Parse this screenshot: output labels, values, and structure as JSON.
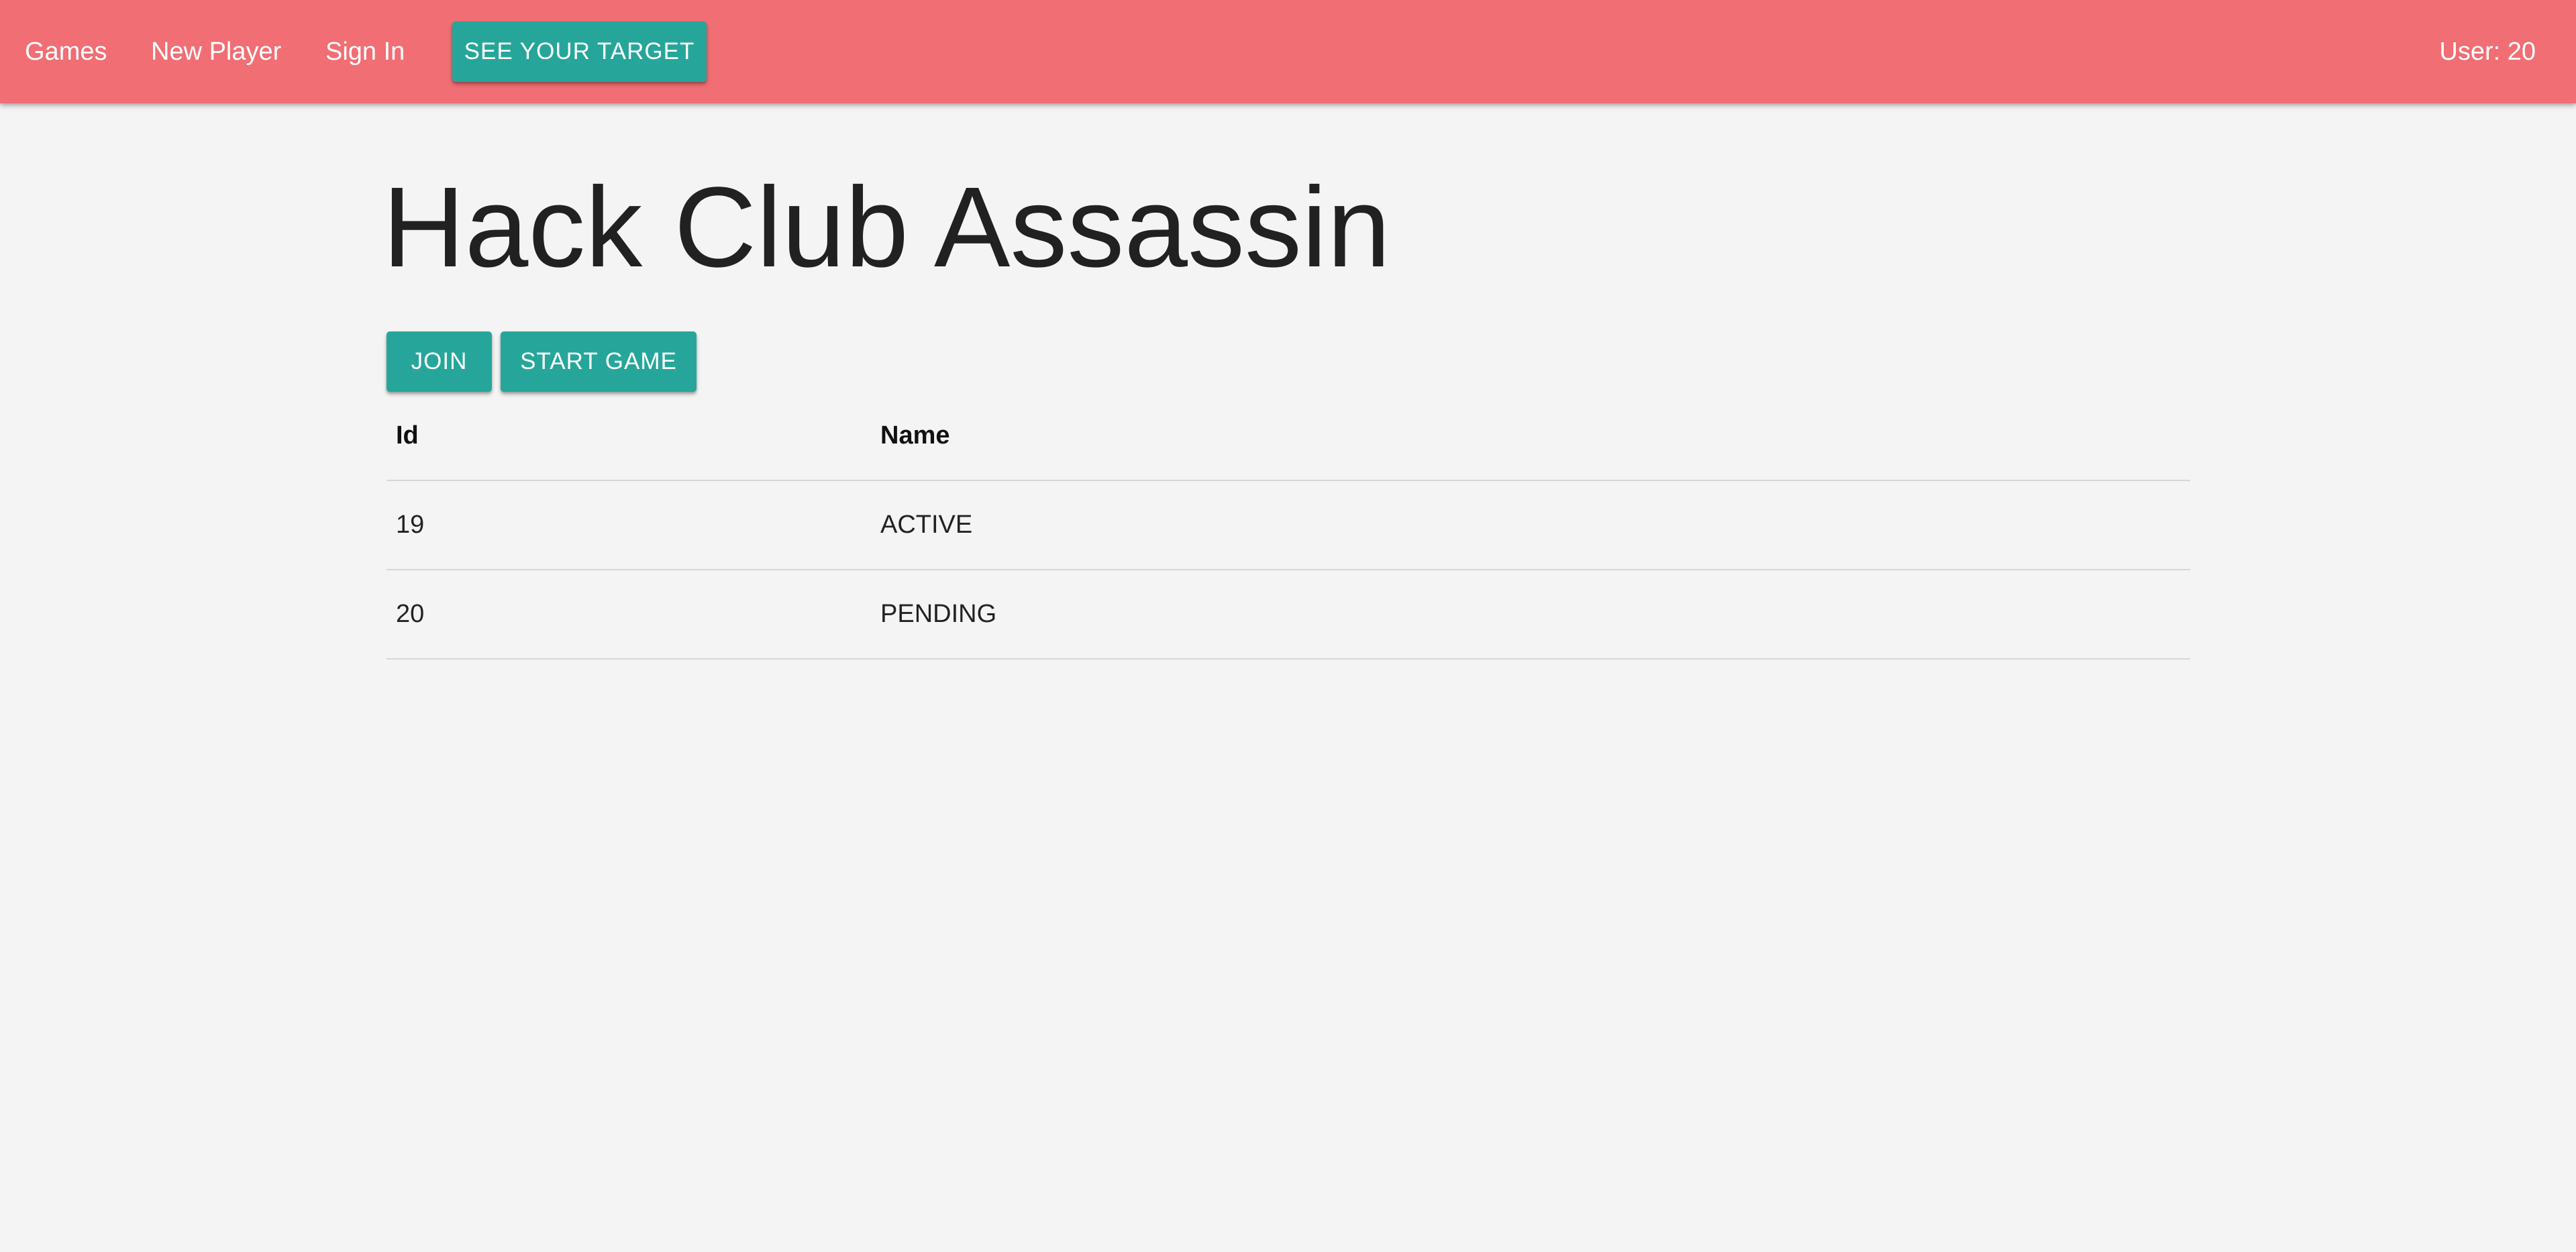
{
  "navbar": {
    "links": [
      "Games",
      "New Player",
      "Sign In"
    ],
    "target_button": "SEE YOUR TARGET",
    "user_label": "User: 20",
    "background_color": "#f06e74"
  },
  "main": {
    "title": "Hack Club Assassin",
    "buttons": {
      "join": "JOIN",
      "start": "START GAME"
    },
    "button_color": "#26a69a",
    "table": {
      "headers": [
        "Id",
        "Name"
      ],
      "rows": [
        [
          "19",
          "ACTIVE"
        ],
        [
          "20",
          "PENDING"
        ]
      ]
    }
  }
}
